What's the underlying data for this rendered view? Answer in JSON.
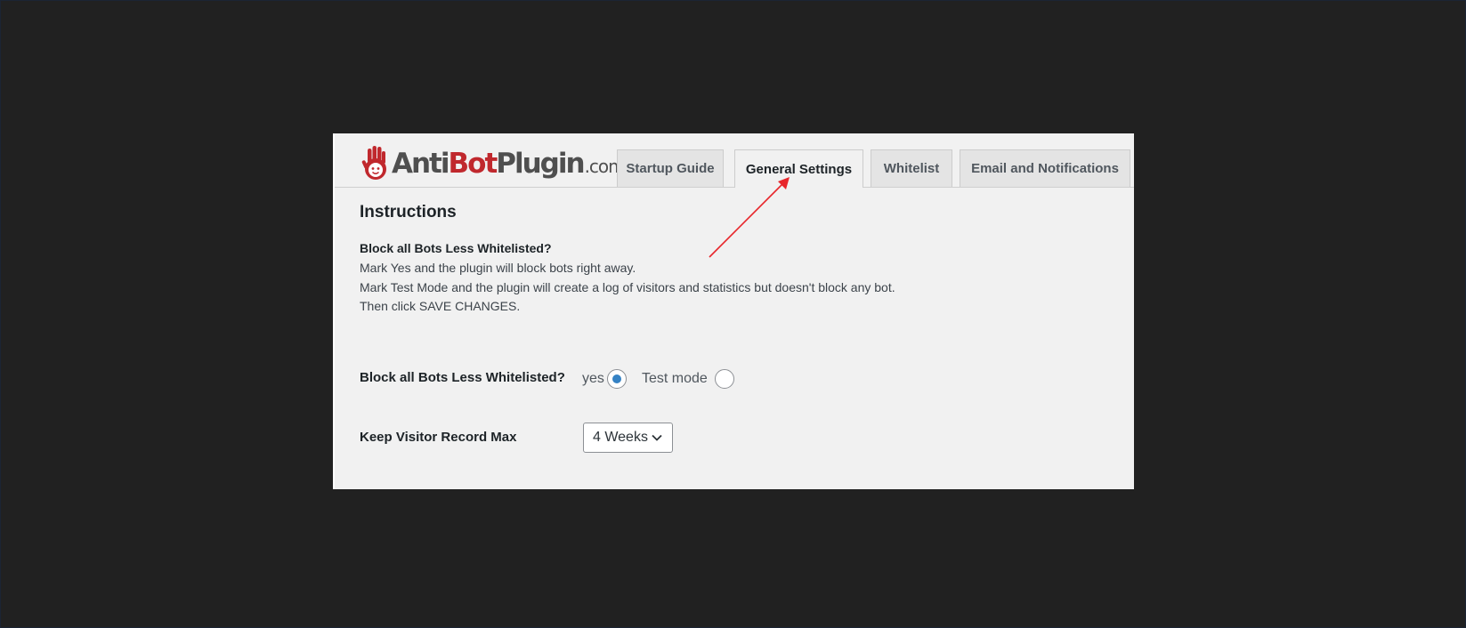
{
  "logo": {
    "part_anti": "Anti",
    "part_bot": "Bot",
    "part_plugin": "Plugin",
    "part_com": ".com"
  },
  "tabs": [
    {
      "label": "Startup Guide",
      "active": false
    },
    {
      "label": "General Settings",
      "active": true
    },
    {
      "label": "Whitelist",
      "active": false
    },
    {
      "label": "Email and Notifications",
      "active": false
    }
  ],
  "instructions": {
    "heading": "Instructions",
    "question": "Block all Bots Less Whitelisted?",
    "line1": "Mark Yes and the plugin will block bots right away.",
    "line2": "Mark Test Mode and the plugin will create a log of visitors and statistics but doesn't block any bot.",
    "line3": "Then click SAVE CHANGES."
  },
  "block_setting": {
    "label": "Block all Bots Less Whitelisted?",
    "option_yes": "yes",
    "option_test": "Test mode",
    "selected": "yes"
  },
  "visitor_record": {
    "label": "Keep Visitor Record Max",
    "selected_value": "4 Weeks"
  },
  "colors": {
    "accent_red": "#c0282d",
    "radio_blue": "#3582c4",
    "annotation_arrow": "#e8262b"
  },
  "icons": {
    "logo": "hand-icon",
    "select": "chevron-down-icon"
  }
}
